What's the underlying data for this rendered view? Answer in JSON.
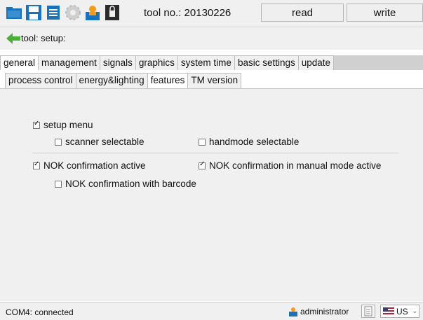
{
  "toolbar": {
    "tool_no": "tool no.: 20130226",
    "read_label": "read",
    "write_label": "write",
    "icons": [
      "open-folder-icon",
      "save-icon",
      "print-icon",
      "settings-icon",
      "user-icon",
      "lock-icon"
    ]
  },
  "breadcrumb": {
    "text": "tool: setup:"
  },
  "tabs_primary": [
    "general",
    "management",
    "signals",
    "graphics",
    "system time",
    "basic settings",
    "update"
  ],
  "tabs_secondary": [
    "process control",
    "energy&lighting",
    "features",
    "TM version"
  ],
  "options": {
    "setup_menu": {
      "label": "setup menu",
      "checked": true
    },
    "scanner_selectable": {
      "label": "scanner selectable",
      "checked": false
    },
    "handmode_selectable": {
      "label": "handmode selectable",
      "checked": false
    },
    "nok_active": {
      "label": "NOK confirmation active",
      "checked": true
    },
    "nok_manual": {
      "label": "NOK confirmation in manual mode active",
      "checked": true
    },
    "nok_barcode": {
      "label": "NOK confirmation with barcode",
      "checked": false
    }
  },
  "status": {
    "connection": "COM4: connected",
    "user": "administrator",
    "language": "US"
  }
}
